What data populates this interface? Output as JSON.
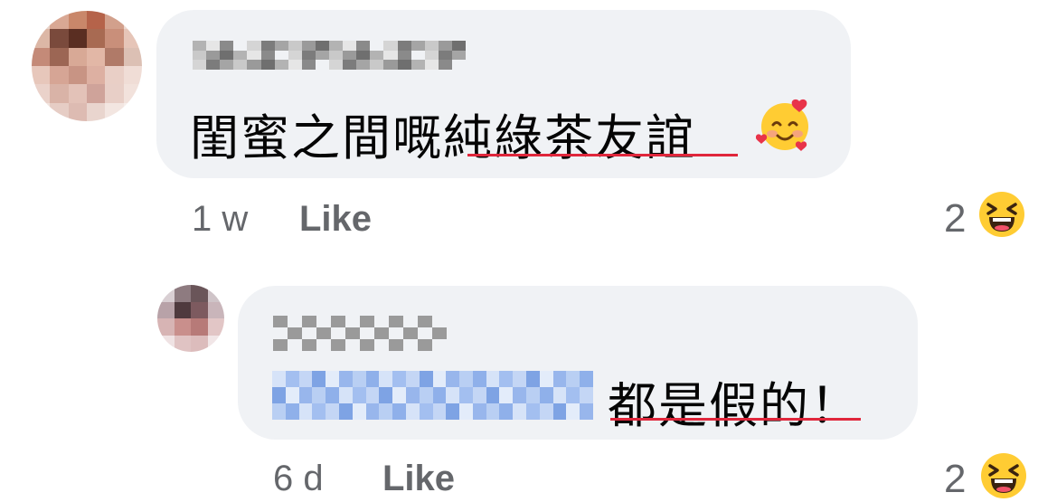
{
  "comments": [
    {
      "author_censored": true,
      "text_prefix": "閨蜜之間嘅",
      "text_underlined": "純綠茶友誼",
      "emoji": "smiling-face-with-hearts-icon",
      "time": "1 w",
      "like_label": "Like",
      "reaction_count": "2",
      "reaction_icon": "haha-reaction-icon"
    },
    {
      "author_censored": true,
      "mention_censored": true,
      "text_underlined": "都是假的！",
      "time": "6 d",
      "like_label": "Like",
      "reaction_count": "2",
      "reaction_icon": "haha-reaction-icon"
    }
  ],
  "colors": {
    "bubble": "#f0f2f5",
    "underline": "#e0263b",
    "meta_text": "#65676b",
    "mention": "#a8c4f0"
  }
}
